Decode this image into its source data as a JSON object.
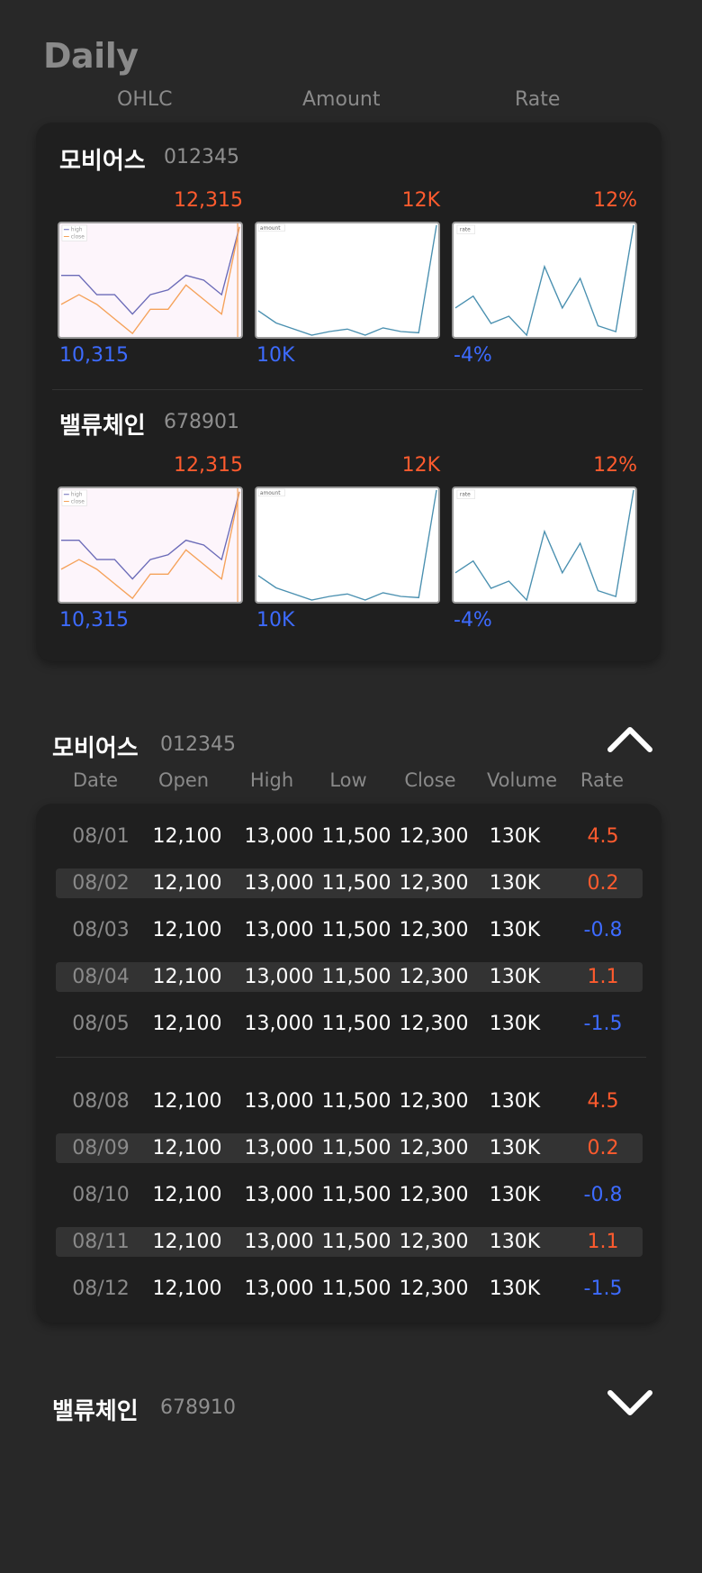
{
  "header": {
    "title": "Daily",
    "tabs": [
      "OHLC",
      "Amount",
      "Rate"
    ]
  },
  "summary": {
    "stocks": [
      {
        "name": "모비어스",
        "code": "012345",
        "ohlc": {
          "top": "12,315",
          "bottom": "10,315",
          "legend": [
            "high",
            "close"
          ]
        },
        "amount": {
          "top": "12K",
          "bottom": "10K",
          "legend": "amount"
        },
        "rate": {
          "top": "12%",
          "bottom": "-4%",
          "legend": "rate"
        }
      },
      {
        "name": "밸류체인",
        "code": "678901",
        "ohlc": {
          "top": "12,315",
          "bottom": "10,315",
          "legend": [
            "high",
            "close"
          ]
        },
        "amount": {
          "top": "12K",
          "bottom": "10K",
          "legend": "amount"
        },
        "rate": {
          "top": "12%",
          "bottom": "-4%",
          "legend": "rate"
        }
      }
    ]
  },
  "detail": {
    "name": "모비어스",
    "code": "012345",
    "columns": [
      "Date",
      "Open",
      "High",
      "Low",
      "Close",
      "Volume",
      "Rate"
    ],
    "weeks": [
      [
        {
          "date": "08/01",
          "open": "12,100",
          "high": "13,000",
          "low": "11,500",
          "close": "12,300",
          "volume": "130K",
          "rate": "4.5",
          "dir": "up"
        },
        {
          "date": "08/02",
          "open": "12,100",
          "high": "13,000",
          "low": "11,500",
          "close": "12,300",
          "volume": "130K",
          "rate": "0.2",
          "dir": "up"
        },
        {
          "date": "08/03",
          "open": "12,100",
          "high": "13,000",
          "low": "11,500",
          "close": "12,300",
          "volume": "130K",
          "rate": "-0.8",
          "dir": "down"
        },
        {
          "date": "08/04",
          "open": "12,100",
          "high": "13,000",
          "low": "11,500",
          "close": "12,300",
          "volume": "130K",
          "rate": "1.1",
          "dir": "up"
        },
        {
          "date": "08/05",
          "open": "12,100",
          "high": "13,000",
          "low": "11,500",
          "close": "12,300",
          "volume": "130K",
          "rate": "-1.5",
          "dir": "down"
        }
      ],
      [
        {
          "date": "08/08",
          "open": "12,100",
          "high": "13,000",
          "low": "11,500",
          "close": "12,300",
          "volume": "130K",
          "rate": "4.5",
          "dir": "up"
        },
        {
          "date": "08/09",
          "open": "12,100",
          "high": "13,000",
          "low": "11,500",
          "close": "12,300",
          "volume": "130K",
          "rate": "0.2",
          "dir": "up"
        },
        {
          "date": "08/10",
          "open": "12,100",
          "high": "13,000",
          "low": "11,500",
          "close": "12,300",
          "volume": "130K",
          "rate": "-0.8",
          "dir": "down"
        },
        {
          "date": "08/11",
          "open": "12,100",
          "high": "13,000",
          "low": "11,500",
          "close": "12,300",
          "volume": "130K",
          "rate": "1.1",
          "dir": "up"
        },
        {
          "date": "08/12",
          "open": "12,100",
          "high": "13,000",
          "low": "11,500",
          "close": "12,300",
          "volume": "130K",
          "rate": "-1.5",
          "dir": "down"
        }
      ]
    ],
    "collapse_icon": "chevron-up-icon"
  },
  "collapsed": {
    "name": "밸류체인",
    "code": "678910",
    "expand_icon": "chevron-down-icon"
  },
  "colors": {
    "background": "#282828",
    "card": "#1f1f1f",
    "up": "#ff5b2e",
    "down": "#3d6bff",
    "muted": "#8a8a8a",
    "series_high": "#6b6bb8",
    "series_close": "#f5a25a",
    "series_line": "#4a90b0"
  },
  "sparkline_data": {
    "high": [
      5,
      5,
      3,
      3,
      1,
      3,
      3.5,
      5,
      4.5,
      3,
      10
    ],
    "close": [
      2,
      3,
      2,
      0.5,
      -1,
      1.5,
      1.5,
      4,
      2.5,
      1,
      10
    ],
    "amount": [
      2,
      1,
      0.5,
      0,
      0.3,
      0.5,
      0,
      0.6,
      0.3,
      0.2,
      9
    ],
    "rate": [
      2,
      3,
      0.7,
      1.3,
      -0.3,
      5.5,
      2,
      4.5,
      0.5,
      0,
      9
    ]
  }
}
